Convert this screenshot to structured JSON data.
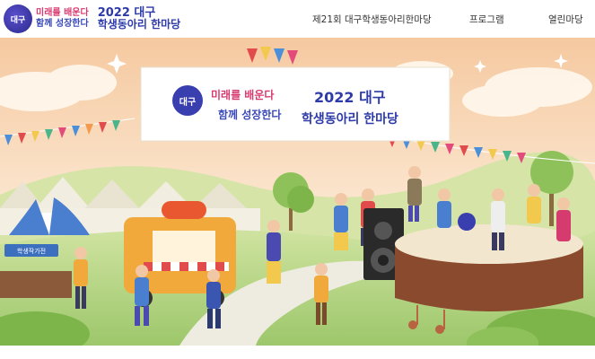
{
  "header": {
    "logo_seal": "대구",
    "slogan_line1": "미래를 배운다",
    "slogan_line2": "함께 성장한다",
    "event_year": "2022 대구",
    "event_name": "학생동아리 한마당"
  },
  "nav": {
    "items": [
      {
        "label": "제21회 대구학생동아리한마당"
      },
      {
        "label": "프로그램"
      },
      {
        "label": "열린마당"
      }
    ]
  },
  "hero": {
    "banner_slogan_line1": "미래를 배운다",
    "banner_slogan_line2": "함께 성장한다",
    "banner_event_year": "2022 대구",
    "banner_event_name": "학생동아리 한마당",
    "booth_sign": "학생작가전",
    "colors": {
      "sky_top": "#f6d9b3",
      "sky_bottom": "#fbe9d3",
      "grass": "#b9d98a",
      "path": "#ecebdc",
      "stage": "#8a4a2e",
      "accent_blue": "#2d3aa8",
      "accent_pink": "#d63b6f"
    }
  }
}
